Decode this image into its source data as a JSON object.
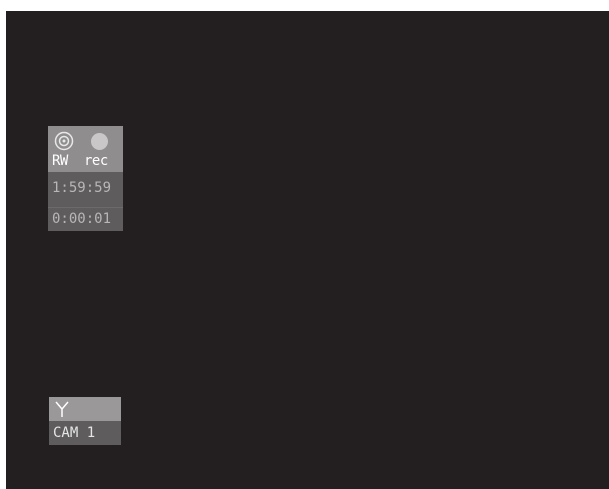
{
  "recorder": {
    "media_label": "RW",
    "rec_label": "rec",
    "time_remaining": "1:59:59",
    "time_elapsed": "0:00:01",
    "icons": [
      "disc-icon",
      "record-dot-icon"
    ]
  },
  "camera": {
    "name": "CAM 1",
    "icon": "antenna-icon"
  },
  "colors": {
    "background": "#231f20",
    "panel_dark": "#5e5c5d",
    "panel_light": "#8f8d8e",
    "text_white": "#ffffff",
    "text_dim": "#b8b6b7"
  }
}
